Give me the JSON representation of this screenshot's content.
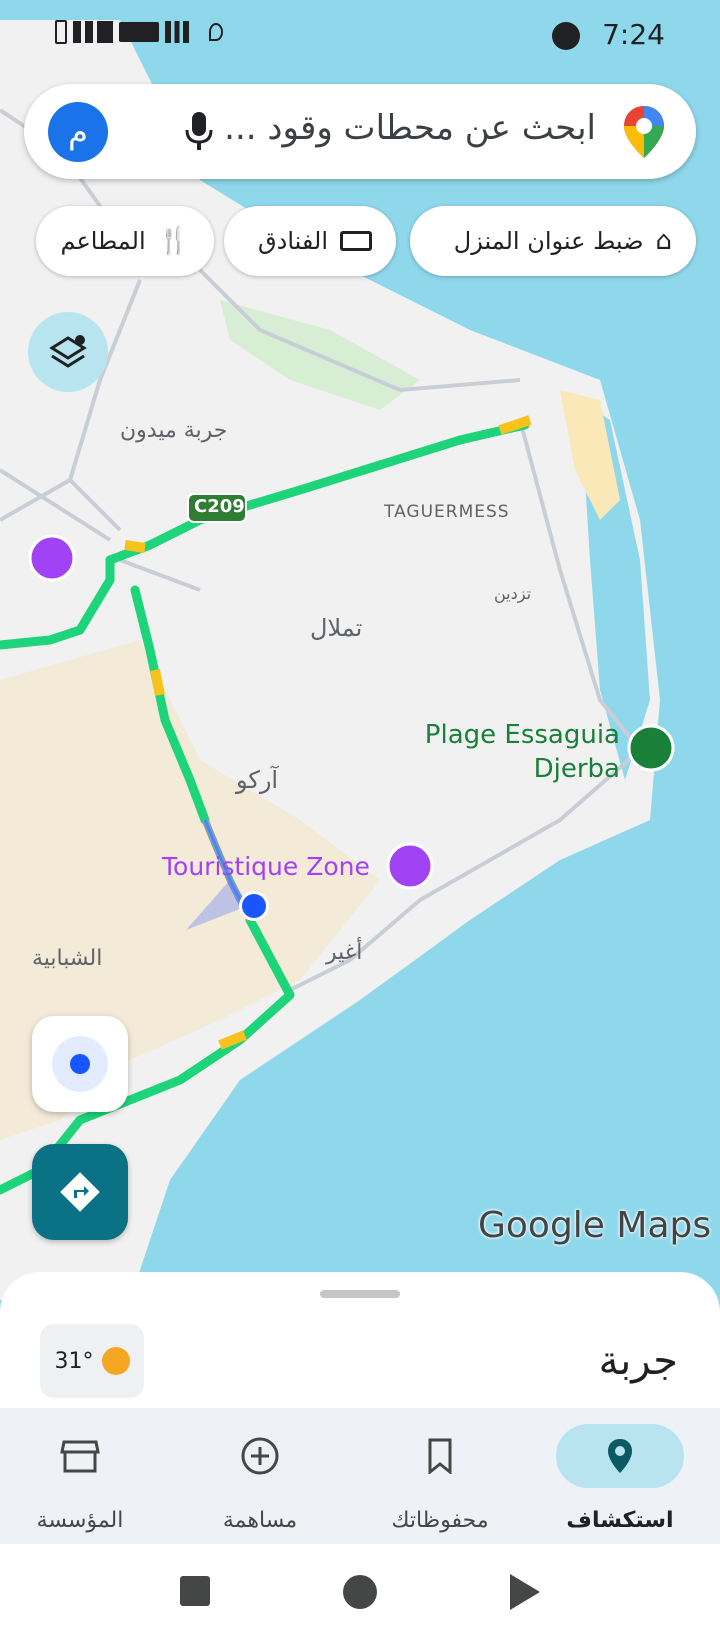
{
  "status": {
    "time": "7:24"
  },
  "search": {
    "avatar_letter": "م",
    "placeholder": "ابحث عن محطات وقود ..."
  },
  "chips": [
    {
      "label": "ضبط عنوان المنزل",
      "icon": "home-icon"
    },
    {
      "label": "الفنادق",
      "icon": "bed-icon"
    },
    {
      "label": "المطاعم",
      "icon": "restaurant-icon"
    }
  ],
  "map": {
    "road_shield": "C209",
    "labels": {
      "midoun": "جربة ميدون",
      "taguermess": "TAGUERMESS",
      "tezdine": "تزدين",
      "tmalal": "تملال",
      "plage": "Plage Essaguia Djerba",
      "arkou": "آركو",
      "touristique": "Touristique Zone",
      "aghir": "أغير",
      "chabbia": "الشبابية"
    },
    "branding": "Google Maps"
  },
  "sheet": {
    "place": "جربة",
    "temperature": "31°"
  },
  "nav": [
    {
      "label": "استكشاف",
      "icon": "explore-pin-icon",
      "active": true
    },
    {
      "label": "محفوظاتك",
      "icon": "bookmark-icon",
      "active": false
    },
    {
      "label": "مساهمة",
      "icon": "add-circle-icon",
      "active": false
    },
    {
      "label": "المؤسسة",
      "icon": "storefront-icon",
      "active": false
    }
  ],
  "colors": {
    "water": "#8fd8ec",
    "land": "#f2f2f2",
    "traffic": "#1ed47a",
    "accent": "#0b7285"
  }
}
